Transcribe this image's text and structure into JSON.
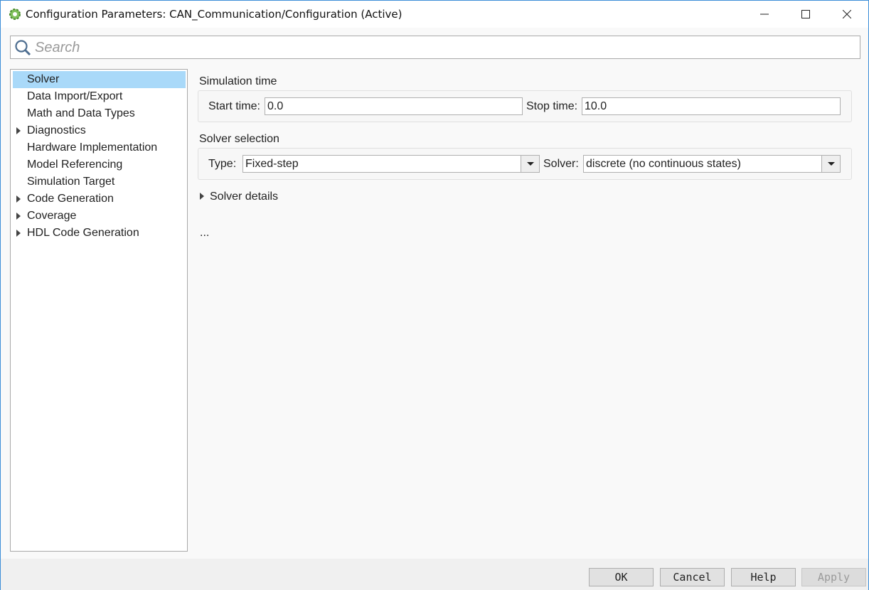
{
  "window": {
    "title": "Configuration Parameters: CAN_Communication/Configuration (Active)",
    "icon": "gear-icon",
    "controls": [
      "minimize",
      "maximize",
      "close"
    ]
  },
  "search": {
    "placeholder": "Search",
    "value": ""
  },
  "sidebar": {
    "items": [
      {
        "label": "Solver",
        "expandable": false,
        "selected": true
      },
      {
        "label": "Data Import/Export",
        "expandable": false
      },
      {
        "label": "Math and Data Types",
        "expandable": false
      },
      {
        "label": "Diagnostics",
        "expandable": true
      },
      {
        "label": "Hardware Implementation",
        "expandable": false
      },
      {
        "label": "Model Referencing",
        "expandable": false
      },
      {
        "label": "Simulation Target",
        "expandable": false
      },
      {
        "label": "Code Generation",
        "expandable": true
      },
      {
        "label": "Coverage",
        "expandable": true
      },
      {
        "label": "HDL Code Generation",
        "expandable": true
      }
    ],
    "selected_color": "#a9d9f9"
  },
  "main": {
    "simulation_time": {
      "title": "Simulation time",
      "start_label": "Start time:",
      "start_value": "0.0",
      "stop_label": "Stop time:",
      "stop_value": "10.0"
    },
    "solver_selection": {
      "title": "Solver selection",
      "type_label": "Type:",
      "type_value": "Fixed-step",
      "solver_label": "Solver:",
      "solver_value": "discrete (no continuous states)"
    },
    "solver_details": "Solver details",
    "ellipsis": "..."
  },
  "footer": {
    "ok": "OK",
    "cancel": "Cancel",
    "help": "Help",
    "apply": "Apply",
    "apply_disabled": true
  }
}
